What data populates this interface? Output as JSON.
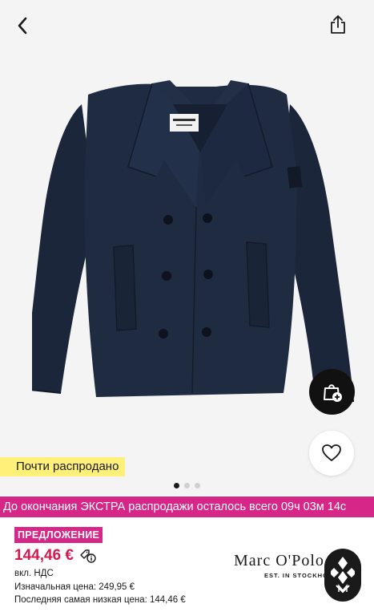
{
  "header": {
    "back_icon": "chevron-left-icon",
    "share_icon": "share-icon"
  },
  "product": {
    "image": "navy-double-breasted-peacoat",
    "badge": "Почти распродано",
    "gallery": {
      "current": 1,
      "total": 3
    }
  },
  "actions": {
    "bag_icon": "shopping-bag-plus-icon",
    "wishlist_icon": "heart-icon"
  },
  "promo": {
    "banner": "До окончания ЭКСТРА распродажи осталось всего 09ч 03м 14с"
  },
  "pricing": {
    "offer_label": "ПРЕДЛОЖЕНИЕ",
    "price": "144,46 €",
    "vat": "вкл. НДС",
    "original_price": "Изначальная цена: 249,95 €",
    "lowest_price": "Последняя самая низкая цена: 144,46 €"
  },
  "brand": {
    "name": "Marc O'Polo",
    "tagline": "EST. IN STOCKHOLM",
    "chat_icon": "assistant-diamond-icon"
  },
  "colors": {
    "promo": "#d62788",
    "price": "#d6184f",
    "badge": "#fff07a",
    "coat": "#1e2a3f"
  }
}
